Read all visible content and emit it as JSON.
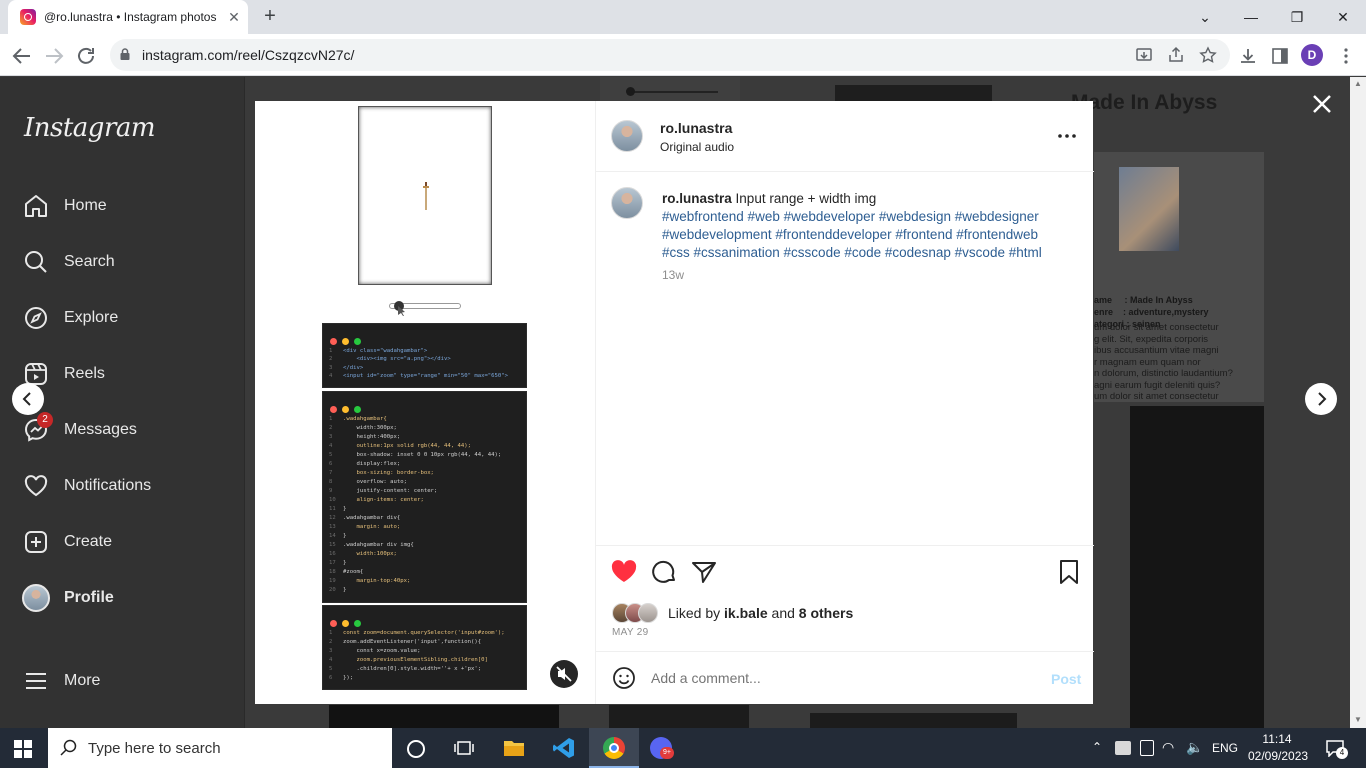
{
  "browser": {
    "tab_title": "@ro.lunastra • Instagram photos",
    "url": "instagram.com/reel/CszqzcvN27c/",
    "profile_initial": "D"
  },
  "sidebar": {
    "logo": "Instagram",
    "items": [
      {
        "label": "Home",
        "icon": "home-icon"
      },
      {
        "label": "Search",
        "icon": "search-icon"
      },
      {
        "label": "Explore",
        "icon": "explore-icon"
      },
      {
        "label": "Reels",
        "icon": "reels-icon"
      },
      {
        "label": "Messages",
        "icon": "messages-icon",
        "badge": "2"
      },
      {
        "label": "Notifications",
        "icon": "heart-icon"
      },
      {
        "label": "Create",
        "icon": "create-icon"
      },
      {
        "label": "Profile",
        "icon": "profile-avatar"
      }
    ],
    "more_label": "More"
  },
  "background": {
    "title": "Made In Abyss",
    "info": [
      "ame     : Made In Abyss",
      "enre    : adventure,mystery",
      "ategori : seinen"
    ],
    "lorem": [
      "um dolor sit amet consectetur",
      "g elit. Sit, expedita corporis",
      "ibus accusantium vitae magni",
      "r magnam eum quam nor",
      "n dolorum, distinctio laudantium?",
      "agni earum fugit deleniti quis?",
      "um dolor sit amet consectetur"
    ]
  },
  "post": {
    "username": "ro.lunastra",
    "audio": "Original audio",
    "caption_user": "ro.lunastra",
    "caption_text": "Input range + width img",
    "hashtags": [
      "#webfrontend #web #webdeveloper #webdesign #webdesigner",
      "#webdevelopment #frontenddeveloper #frontend #frontendweb",
      "#css #cssanimation #csscode #code #codesnap #vscode #html"
    ],
    "age": "13w",
    "liked_prefix": "Liked by",
    "liked_user": "ik.bale",
    "liked_and": "and",
    "liked_others": "8 others",
    "date": "MAY 29",
    "comment_placeholder": "Add a comment...",
    "post_button": "Post",
    "liked": true
  },
  "media": {
    "code1": [
      [
        "1",
        "<div class=\"wadahgambar\">"
      ],
      [
        "2",
        "    <div><img src=\"a.png\"></div>"
      ],
      [
        "3",
        "</div>"
      ],
      [
        "4",
        "<input id=\"zoom\" type=\"range\" min=\"50\" max=\"650\">"
      ]
    ],
    "code2": [
      [
        "1",
        ".wadahgambar{"
      ],
      [
        "2",
        "    width:300px;"
      ],
      [
        "3",
        "    height:400px;"
      ],
      [
        "4",
        "    outline:1px solid rgb(44, 44, 44);"
      ],
      [
        "5",
        "    box-shadow: inset 0 0 10px rgb(44, 44, 44);"
      ],
      [
        "6",
        "    display:flex;"
      ],
      [
        "7",
        "    box-sizing: border-box;"
      ],
      [
        "8",
        "    overflow: auto;"
      ],
      [
        "9",
        "    justify-content: center;"
      ],
      [
        "10",
        "    align-items: center;"
      ],
      [
        "11",
        "}"
      ],
      [
        "12",
        ".wadahgambar div{"
      ],
      [
        "13",
        "    margin: auto;"
      ],
      [
        "14",
        "}"
      ],
      [
        "15",
        ".wadahgambar div img{"
      ],
      [
        "16",
        "    width:100px;"
      ],
      [
        "17",
        "}"
      ],
      [
        "18",
        "#zoom{"
      ],
      [
        "19",
        "    margin-top:40px;"
      ],
      [
        "20",
        "}"
      ]
    ],
    "code3": [
      [
        "1",
        "const zoom=document.querySelector('input#zoom');"
      ],
      [
        "2",
        "zoom.addEventListener('input',function(){"
      ],
      [
        "3",
        "    const x=zoom.value;"
      ],
      [
        "4",
        "    zoom.previousElementSibling.children[0]"
      ],
      [
        "5",
        "    .children[0].style.width=''+ x +'px';"
      ],
      [
        "6",
        "});"
      ]
    ],
    "slider_value_fraction": 0.08
  },
  "taskbar": {
    "search_placeholder": "Type here to search",
    "language": "ENG",
    "time": "11:14",
    "date": "02/09/2023",
    "notification_count": "4"
  },
  "colors": {
    "accent": "#0095f6",
    "like": "#ff3040",
    "hashtag": "#00376b"
  }
}
